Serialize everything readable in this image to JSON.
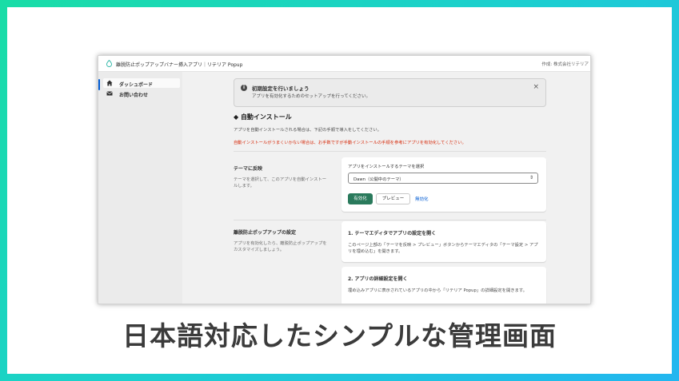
{
  "app": {
    "title": "離脱防止ポップアップバナー挿入アプリ｜リテリア Popup",
    "author": "作成: 株式会社リテリア"
  },
  "sidebar": {
    "items": [
      {
        "label": "ダッシュボード",
        "icon": "home-icon",
        "active": true
      },
      {
        "label": "お問い合わせ",
        "icon": "mail-icon",
        "active": false
      }
    ]
  },
  "banner": {
    "title": "初期設定を行いましょう",
    "description": "アプリを有効化するためのセットアップを行ってください。",
    "close": "×"
  },
  "auto_install": {
    "heading": "◆ 自動インストール",
    "description": "アプリを自動インストールされる場合は、下記の手順で導入をしてください。",
    "warning": "自動インストールがうまくいかない場合は、お手数ですが手動インストールの手順を参考にアプリを有効化してください。"
  },
  "theme_section": {
    "title": "テーマに反映",
    "description": "テーマを選択して、このアプリを自動インストールします。",
    "select_label": "アプリをインストールするテーマを選択",
    "select_value": "Dawn（公開中のテーマ）",
    "select_arrow": "⇕",
    "enable_button": "有効化",
    "preview_button": "プレビュー",
    "disable_link": "無効化"
  },
  "popup_section": {
    "title": "離脱防止ポップアップの設定",
    "description": "アプリを有効化したら、離脱防止ポップアップをカスタマイズしましょう。",
    "steps": [
      {
        "title": "1. テーマエディタでアプリの設定を開く",
        "description": "このページ上部の「テーマを反映 > プレビュー」ボタンからテーマエディタの「テーマ設定 > アプリを埋め込む」を開きます。"
      },
      {
        "title": "2. アプリの詳細設定を開く",
        "description": "埋め込みアプリに表示されているアプリの中から「リテリア Popup」の詳細設定を開きます。"
      }
    ]
  },
  "caption": "日本語対応したシンプルな管理画面",
  "colors": {
    "frame_gradient_start": "#19dda6",
    "frame_gradient_end": "#22b6f0",
    "primary_button": "#2a7a5c",
    "warning_text": "#d72c0d",
    "link": "#005bd3"
  }
}
